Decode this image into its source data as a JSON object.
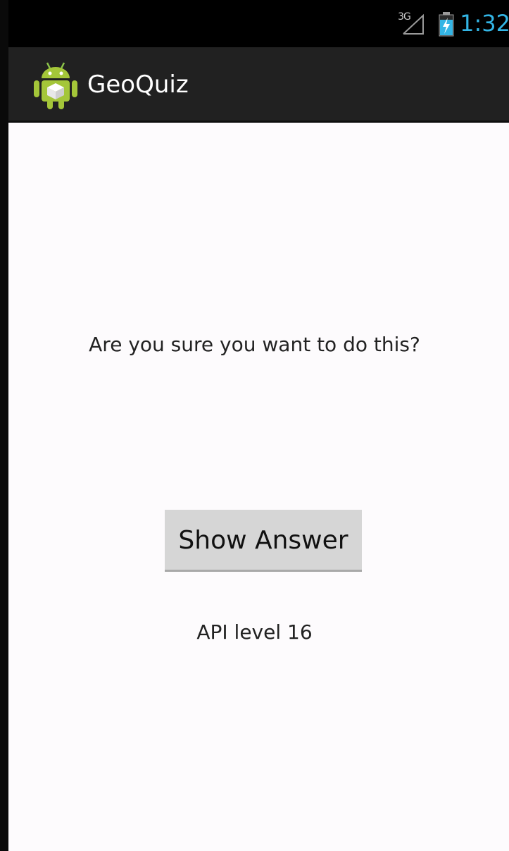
{
  "status_bar": {
    "network_label": "3G",
    "signal_icon": "signal-icon",
    "battery_icon": "battery-charging-icon",
    "time": "1:32",
    "time_color": "#33b5e5"
  },
  "action_bar": {
    "app_icon": "android-app-icon",
    "title": "GeoQuiz",
    "background_color": "#212121"
  },
  "main": {
    "question_text": "Are you sure you want to do this?",
    "show_answer_label": "Show Answer",
    "api_level_text": "API level 16"
  }
}
